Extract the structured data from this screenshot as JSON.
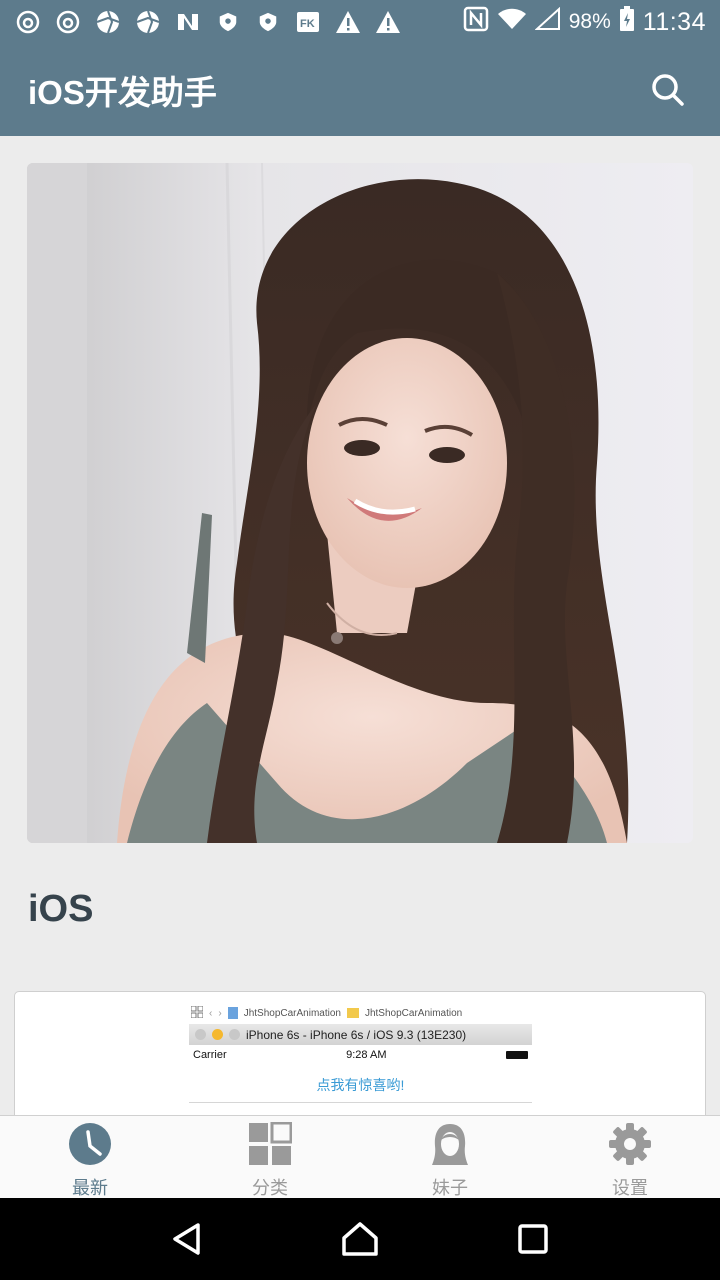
{
  "status_bar": {
    "battery": "98%",
    "time": "11:34",
    "left_icons": [
      "netease-music-icon",
      "netease-music-icon",
      "aperture-icon",
      "aperture-icon",
      "n-app-icon",
      "shield-icon",
      "shield-icon",
      "fk-app-icon",
      "warning-icon",
      "warning-icon"
    ]
  },
  "app_bar": {
    "title": "iOS开发助手",
    "search_icon": "search-icon"
  },
  "feed": {
    "section_title": "iOS",
    "card": {
      "breadcrumb_1": "JhtShopCarAnimation",
      "breadcrumb_2": "JhtShopCarAnimation",
      "device_title": "iPhone 6s - iPhone 6s / iOS 9.3 (13E230)",
      "carrier": "Carrier",
      "sim_time": "9:28 AM",
      "link_text": "点我有惊喜哟!"
    }
  },
  "bottom_nav": {
    "items": [
      {
        "label": "最新",
        "icon": "clock-icon",
        "active": true
      },
      {
        "label": "分类",
        "icon": "grid-icon",
        "active": false
      },
      {
        "label": "妹子",
        "icon": "girl-icon",
        "active": false
      },
      {
        "label": "设置",
        "icon": "gear-icon",
        "active": false
      }
    ]
  },
  "colors": {
    "primary": "#5d7b8c",
    "background": "#ececec",
    "inactive": "#9a9a9a"
  }
}
